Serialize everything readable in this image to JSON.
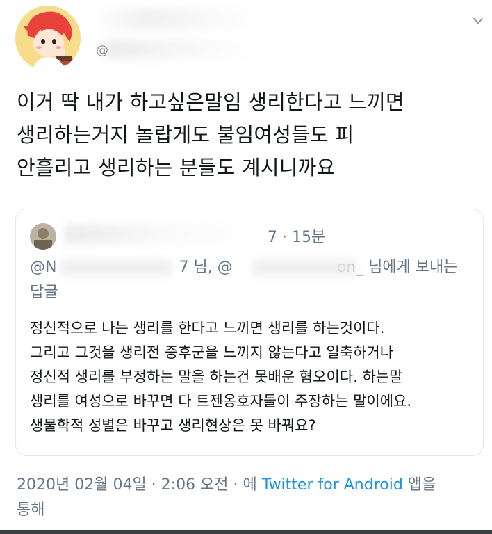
{
  "tweet": {
    "text_lines": [
      "이거 딱 내가 하고싶은말임 생리한다고 느끼면",
      "생리하는거지 놀랍게도 불임여성들도 피",
      "안흘리고 생리하는 분들도 계시니까요"
    ],
    "handle_glyph": "@",
    "avatar_icon": "cartoon-avatar-icon",
    "menu_icon": "chevron-down-icon"
  },
  "quoted": {
    "time": "7 · 15분",
    "reply_prefix": "@N",
    "reply_mid": "7 님, @",
    "reply_suffix": "on_ 님에게 보내는",
    "reply_line2": "답글",
    "body_lines": [
      "정신적으로 나는 생리를 한다고 느끼면 생리를 하는것이다.",
      "그리고 그것을 생리전 증후군을 느끼지 않는다고 일축하거나",
      "정신적 생리를 부정하는 말을 하는건 못배운 혐오이다. 하는말",
      "생리를 여성으로 바꾸면 다 트젠옹호자들이 주장하는 말이에요.",
      "생물학적 성별은 바꾸고 생리현상은 못 바꿔요?"
    ]
  },
  "meta": {
    "date": "2020년 02월 04일 · 2:06 오전 · 에 ",
    "source": "Twitter for Android",
    "after_source": " 앱을",
    "line2": "통해"
  },
  "colors": {
    "text": "#14171a",
    "muted": "#657786",
    "link": "#1b95e0",
    "border": "#e1e8ed"
  }
}
